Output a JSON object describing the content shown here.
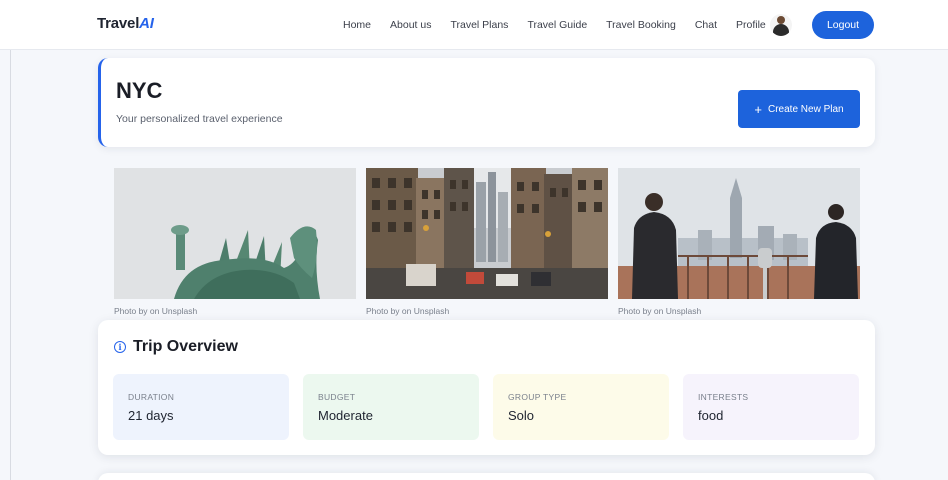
{
  "brand": {
    "name": "Travel",
    "accent": "AI"
  },
  "nav": {
    "links": [
      "Home",
      "About us",
      "Travel Plans",
      "Travel Guide",
      "Travel Booking",
      "Chat"
    ],
    "profile_label": "Profile",
    "logout_label": "Logout"
  },
  "header": {
    "title": "NYC",
    "subtitle": "Your personalized travel experience",
    "create_button": "Create New Plan"
  },
  "photos": [
    {
      "credit": "Photo by on Unsplash"
    },
    {
      "credit": "Photo by on Unsplash"
    },
    {
      "credit": "Photo by on Unsplash"
    }
  ],
  "overview": {
    "title": "Trip Overview",
    "stats": [
      {
        "label": "DURATION",
        "value": "21 days",
        "bg": "#eef3fd"
      },
      {
        "label": "BUDGET",
        "value": "Moderate",
        "bg": "#ecf8ef"
      },
      {
        "label": "GROUP TYPE",
        "value": "Solo",
        "bg": "#fdfbe9"
      },
      {
        "label": "INTERESTS",
        "value": "food",
        "bg": "#f6f3fc"
      }
    ]
  },
  "colors": {
    "accent": "#1d63dc",
    "background": "#f5f7fb"
  }
}
